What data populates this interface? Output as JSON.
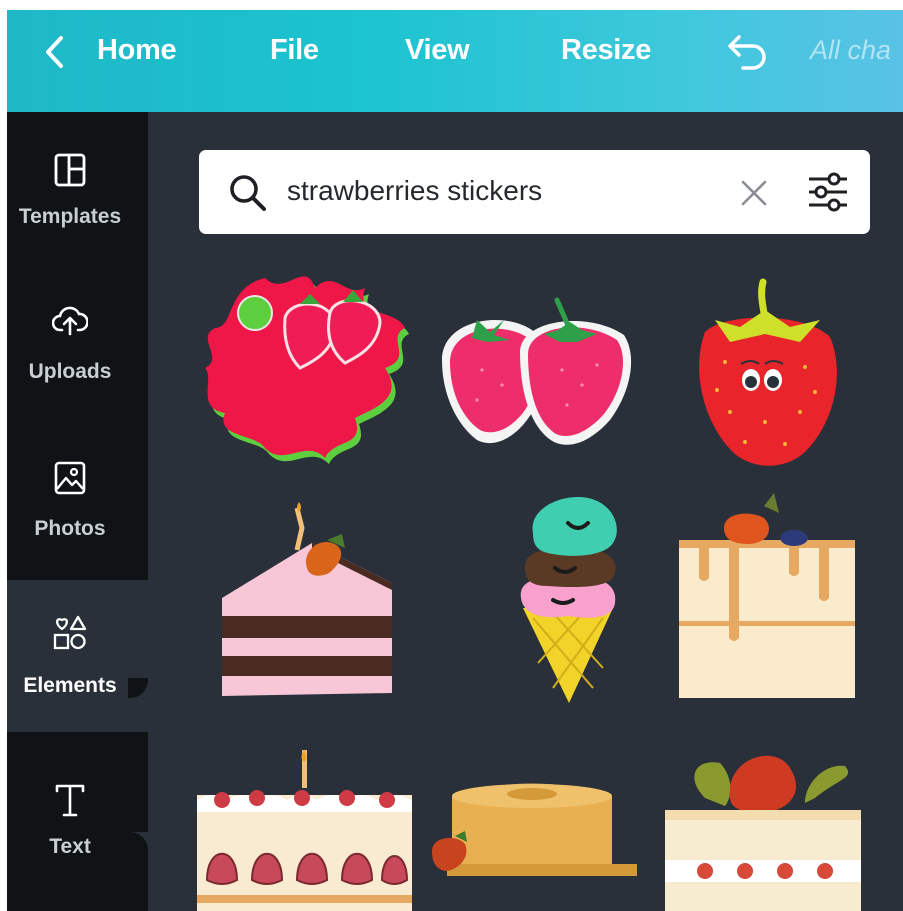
{
  "topbar": {
    "back_icon": "chevron-left-icon",
    "home_label": "Home",
    "file_label": "File",
    "view_label": "View",
    "resize_label": "Resize",
    "undo_icon": "undo-icon",
    "status_text": "All cha"
  },
  "sidebar": {
    "items": [
      {
        "label": "Templates",
        "icon": "templates-icon"
      },
      {
        "label": "Uploads",
        "icon": "upload-cloud-icon"
      },
      {
        "label": "Photos",
        "icon": "image-icon"
      },
      {
        "label": "Elements",
        "icon": "shapes-icon"
      },
      {
        "label": "Text",
        "icon": "text-icon"
      }
    ],
    "active": "Elements"
  },
  "search": {
    "value": "strawberries stickers",
    "icon": "search-icon",
    "clear_icon": "close-icon",
    "filter_icon": "sliders-icon"
  },
  "stickers": [
    {
      "name": "strawberry-splash-sticker"
    },
    {
      "name": "two-strawberries-sticker"
    },
    {
      "name": "smiling-strawberry-sticker"
    },
    {
      "name": "cake-slice-sticker"
    },
    {
      "name": "ice-cream-cone-sticker"
    },
    {
      "name": "drip-cake-sticker"
    },
    {
      "name": "strawberry-shortcake-sticker"
    },
    {
      "name": "chiffon-cake-sticker"
    },
    {
      "name": "strawberry-layer-cake-sticker"
    }
  ],
  "colors": {
    "topbar_gradient": [
      "#1fb8c7",
      "#59c2e6"
    ],
    "sidebar_bg": "#0f1316",
    "panel_bg": "#293039",
    "strawberry_red": "#e8194f",
    "leaf_green": "#4bbf3c"
  }
}
